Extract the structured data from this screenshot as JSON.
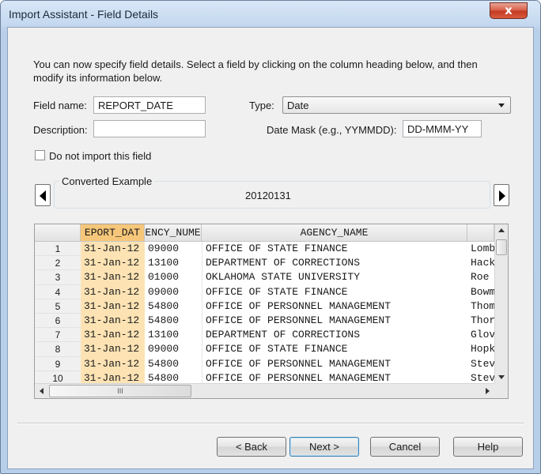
{
  "window": {
    "title": "Import Assistant - Field Details",
    "close_glyph": "x"
  },
  "intro_text": "You can now specify field details. Select a field by clicking on the column heading below, and then modify its information below.",
  "form": {
    "field_name_label": "Field name:",
    "field_name_value": "REPORT_DATE",
    "description_label": "Description:",
    "description_value": "",
    "type_label": "Type:",
    "type_value": "Date",
    "date_mask_label": "Date Mask (e.g., YYMMDD):",
    "date_mask_value": "DD-MMM-YY",
    "do_not_import_label": "Do not import this field",
    "do_not_import_checked": false
  },
  "converted_example": {
    "title": "Converted Example",
    "value": "20120131"
  },
  "grid": {
    "headers": [
      "EPORT_DAT",
      "ENCY_NUME",
      "AGENCY_NAME",
      ""
    ],
    "selected_column_color": "#fde3b4",
    "selected_header_color": "#f6c77a",
    "rows": [
      {
        "num": "1",
        "date": "31-Jan-12",
        "agency_num": "09000",
        "agency_name": "OFFICE OF STATE FINANCE",
        "extra": "Lomb"
      },
      {
        "num": "2",
        "date": "31-Jan-12",
        "agency_num": "13100",
        "agency_name": "DEPARTMENT OF CORRECTIONS",
        "extra": "Hack"
      },
      {
        "num": "3",
        "date": "31-Jan-12",
        "agency_num": "01000",
        "agency_name": "OKLAHOMA STATE UNIVERSITY",
        "extra": "Roe"
      },
      {
        "num": "4",
        "date": "31-Jan-12",
        "agency_num": "09000",
        "agency_name": "OFFICE OF STATE FINANCE",
        "extra": "Bowm"
      },
      {
        "num": "5",
        "date": "31-Jan-12",
        "agency_num": "54800",
        "agency_name": "OFFICE OF PERSONNEL MANAGEMENT",
        "extra": "Thom"
      },
      {
        "num": "6",
        "date": "31-Jan-12",
        "agency_num": "54800",
        "agency_name": "OFFICE OF PERSONNEL MANAGEMENT",
        "extra": "Thor"
      },
      {
        "num": "7",
        "date": "31-Jan-12",
        "agency_num": "13100",
        "agency_name": "DEPARTMENT OF CORRECTIONS",
        "extra": "Glov"
      },
      {
        "num": "8",
        "date": "31-Jan-12",
        "agency_num": "09000",
        "agency_name": "OFFICE OF STATE FINANCE",
        "extra": "Hopk"
      },
      {
        "num": "9",
        "date": "31-Jan-12",
        "agency_num": "54800",
        "agency_name": "OFFICE OF PERSONNEL MANAGEMENT",
        "extra": "Stev"
      },
      {
        "num": "10",
        "date": "31-Jan-12",
        "agency_num": "54800",
        "agency_name": "OFFICE OF PERSONNEL MANAGEMENT",
        "extra": "Stev"
      }
    ],
    "hscroll_grip": "III"
  },
  "buttons": {
    "back": "< Back",
    "next": "Next >",
    "cancel": "Cancel",
    "help": "Help"
  }
}
